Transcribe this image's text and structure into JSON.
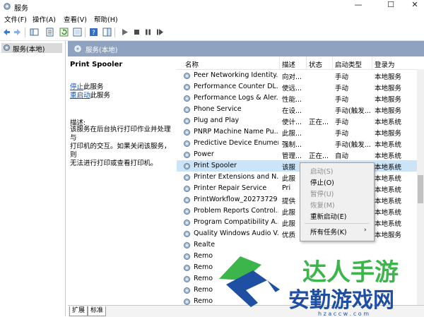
{
  "window": {
    "title": "服务",
    "minimize": "—",
    "maximize": "☐",
    "close": "✕"
  },
  "menu": [
    "文件(F)",
    "操作(A)",
    "查看(V)",
    "帮助(H)"
  ],
  "tree": {
    "root_label": "服务(本地)"
  },
  "main_header": {
    "label": "服务(本地)"
  },
  "details": {
    "service_name": "Print Spooler",
    "stop_link": "停止",
    "stop_suffix": "此服务",
    "restart_link": "重启动",
    "restart_suffix": "此服务",
    "description_label": "描述:",
    "description_lines": [
      "该服务在后台执行打印作业并处理与",
      "打印机的交互。如果关闭该服务，则",
      "无法进行打印或查看打印机。"
    ]
  },
  "columns": {
    "name": "名称",
    "desc": "描述",
    "state": "状态",
    "startup": "启动类型",
    "logon": "登录为"
  },
  "services": [
    {
      "name": "Peer Networking Identity...",
      "desc": "向对...",
      "state": "",
      "startup": "手动",
      "logon": "本地服务"
    },
    {
      "name": "Performance Counter DL...",
      "desc": "使远...",
      "state": "",
      "startup": "手动",
      "logon": "本地服务"
    },
    {
      "name": "Performance Logs & Aler...",
      "desc": "性能...",
      "state": "",
      "startup": "手动",
      "logon": "本地服务"
    },
    {
      "name": "Phone Service",
      "desc": "在设...",
      "state": "",
      "startup": "手动(触发...",
      "logon": "本地服务"
    },
    {
      "name": "Plug and Play",
      "desc": "使计...",
      "state": "正在...",
      "startup": "手动",
      "logon": "本地系统"
    },
    {
      "name": "PNRP Machine Name Pu...",
      "desc": "此服...",
      "state": "",
      "startup": "手动",
      "logon": "本地服务"
    },
    {
      "name": "Predictive Device Enumera...",
      "desc": "强制...",
      "state": "",
      "startup": "手动(触发...",
      "logon": "本地系统"
    },
    {
      "name": "Power",
      "desc": "管理...",
      "state": "正在...",
      "startup": "自动",
      "logon": "本地系统"
    },
    {
      "name": "Print Spooler",
      "desc": "该服",
      "state": "",
      "startup": "",
      "logon": "本地系统"
    },
    {
      "name": "Printer Extensions and N...",
      "desc": "此服",
      "state": "",
      "startup": "",
      "logon": "本地系统"
    },
    {
      "name": "Printer Repair Service",
      "desc": "Pri",
      "state": "",
      "startup": "",
      "logon": "本地系统"
    },
    {
      "name": "PrintWorkflow_20273729",
      "desc": "提供",
      "state": "",
      "startup": "",
      "logon": "本地系统"
    },
    {
      "name": "Problem Reports Control...",
      "desc": "此服",
      "state": "",
      "startup": "",
      "logon": "本地系统"
    },
    {
      "name": "Program Compatibility A...",
      "desc": "此服",
      "state": "",
      "startup": "",
      "logon": "本地系统"
    },
    {
      "name": "Quality Windows Audio V...",
      "desc": "优质",
      "state": "",
      "startup": "",
      "logon": "本地服务"
    },
    {
      "name": "Realte",
      "desc": "",
      "state": "",
      "startup": "",
      "logon": ""
    },
    {
      "name": "Remo",
      "desc": "",
      "state": "",
      "startup": "",
      "logon": ""
    },
    {
      "name": "Remo",
      "desc": "",
      "state": "",
      "startup": "",
      "logon": ""
    },
    {
      "name": "Remo",
      "desc": "",
      "state": "",
      "startup": "",
      "logon": ""
    },
    {
      "name": "Remo",
      "desc": "",
      "state": "",
      "startup": "",
      "logon": ""
    },
    {
      "name": "Remo",
      "desc": "",
      "state": "",
      "startup": "",
      "logon": ""
    }
  ],
  "selected_index": 8,
  "context_menu": {
    "start": "启动(S)",
    "stop": "停止(O)",
    "pause": "暂停(U)",
    "resume": "恢复(M)",
    "restart": "重新启动(E)",
    "all_tasks": "所有任务(K)",
    "submenu_arrow": "›"
  },
  "tabs": [
    "扩展",
    "标准"
  ],
  "logo": {
    "top_text": "达人手游",
    "bottom_text": "安勤游戏网",
    "url_text": "h z a c c w . c o m"
  },
  "colors": {
    "header_strip": "#8fa3c0",
    "selection": "#cce4f7",
    "link": "#1a54b4",
    "logo_green": "#3cb54a",
    "logo_blue": "#1e4fa3"
  }
}
